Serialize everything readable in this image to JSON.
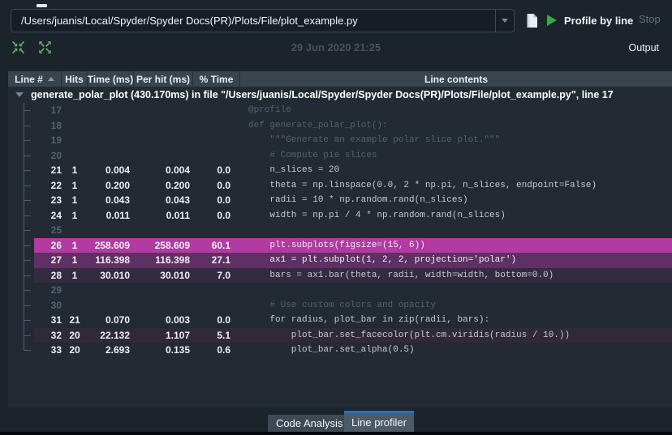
{
  "toolbar": {
    "path_value": "/Users/juanis/Local/Spyder/Spyder Docs(PR)/Plots/File/plot_example.py",
    "profile_button_label": "Profile by line",
    "stop_button_label": "Stop"
  },
  "statusbar": {
    "timestamp": "29 Jun 2020 21:25",
    "output_label": "Output"
  },
  "table": {
    "columns": [
      "Line #",
      "Hits",
      "Time (ms)",
      "Per hit (ms)",
      "% Time",
      "Line contents"
    ],
    "root_label": "generate_polar_plot (430.170ms) in file \"/Users/juanis/Local/Spyder/Spyder Docs(PR)/Plots/File/plot_example.py\", line 17",
    "rows": [
      {
        "line": "17",
        "hits": "",
        "time": "",
        "per_hit": "",
        "pct": "",
        "code": "@profile",
        "active": false,
        "highlight": null
      },
      {
        "line": "18",
        "hits": "",
        "time": "",
        "per_hit": "",
        "pct": "",
        "code": "def generate_polar_plot():",
        "active": false,
        "highlight": null
      },
      {
        "line": "19",
        "hits": "",
        "time": "",
        "per_hit": "",
        "pct": "",
        "code": "    \"\"\"Generate an example polar slice plot.\"\"\"",
        "active": false,
        "highlight": null
      },
      {
        "line": "20",
        "hits": "",
        "time": "",
        "per_hit": "",
        "pct": "",
        "code": "    # Compute pie slices",
        "active": false,
        "highlight": null
      },
      {
        "line": "21",
        "hits": "1",
        "time": "0.004",
        "per_hit": "0.004",
        "pct": "0.0",
        "code": "    n_slices = 20",
        "active": true,
        "highlight": null
      },
      {
        "line": "22",
        "hits": "1",
        "time": "0.200",
        "per_hit": "0.200",
        "pct": "0.0",
        "code": "    theta = np.linspace(0.0, 2 * np.pi, n_slices, endpoint=False)",
        "active": true,
        "highlight": null
      },
      {
        "line": "23",
        "hits": "1",
        "time": "0.043",
        "per_hit": "0.043",
        "pct": "0.0",
        "code": "    radii = 10 * np.random.rand(n_slices)",
        "active": true,
        "highlight": null
      },
      {
        "line": "24",
        "hits": "1",
        "time": "0.011",
        "per_hit": "0.011",
        "pct": "0.0",
        "code": "    width = np.pi / 4 * np.random.rand(n_slices)",
        "active": true,
        "highlight": null
      },
      {
        "line": "25",
        "hits": "",
        "time": "",
        "per_hit": "",
        "pct": "",
        "code": "",
        "active": false,
        "highlight": null
      },
      {
        "line": "26",
        "hits": "1",
        "time": "258.609",
        "per_hit": "258.609",
        "pct": "60.1",
        "code": "    plt.subplots(figsize=(15, 6))",
        "active": true,
        "highlight": "h1"
      },
      {
        "line": "27",
        "hits": "1",
        "time": "116.398",
        "per_hit": "116.398",
        "pct": "27.1",
        "code": "    ax1 = plt.subplot(1, 2, 2, projection='polar')",
        "active": true,
        "highlight": "h2"
      },
      {
        "line": "28",
        "hits": "1",
        "time": "30.010",
        "per_hit": "30.010",
        "pct": "7.0",
        "code": "    bars = ax1.bar(theta, radii, width=width, bottom=0.0)",
        "active": true,
        "highlight": "h3"
      },
      {
        "line": "29",
        "hits": "",
        "time": "",
        "per_hit": "",
        "pct": "",
        "code": "",
        "active": false,
        "highlight": null
      },
      {
        "line": "30",
        "hits": "",
        "time": "",
        "per_hit": "",
        "pct": "",
        "code": "    # Use custom colors and opacity",
        "active": false,
        "highlight": null
      },
      {
        "line": "31",
        "hits": "21",
        "time": "0.070",
        "per_hit": "0.003",
        "pct": "0.0",
        "code": "    for radius, plot_bar in zip(radii, bars):",
        "active": true,
        "highlight": null
      },
      {
        "line": "32",
        "hits": "20",
        "time": "22.132",
        "per_hit": "1.107",
        "pct": "5.1",
        "code": "        plot_bar.set_facecolor(plt.cm.viridis(radius / 10.))",
        "active": true,
        "highlight": "h4"
      },
      {
        "line": "33",
        "hits": "20",
        "time": "2.693",
        "per_hit": "0.135",
        "pct": "0.6",
        "code": "        plot_bar.set_alpha(0.5)",
        "active": true,
        "highlight": null
      }
    ]
  },
  "tabs": [
    {
      "label": "Code Analysis",
      "active": false
    },
    {
      "label": "Line profiler",
      "active": true
    }
  ],
  "colors": {
    "highlight_high": "#b23aa0",
    "highlight_medium": "#5f3063",
    "highlight_low": "#332b41",
    "highlight_subtle": "#302938",
    "accent_green": "#36a93f",
    "tab_active_border": "#1f74bd",
    "table_background": "#222a33",
    "window_background": "#1b232b"
  }
}
